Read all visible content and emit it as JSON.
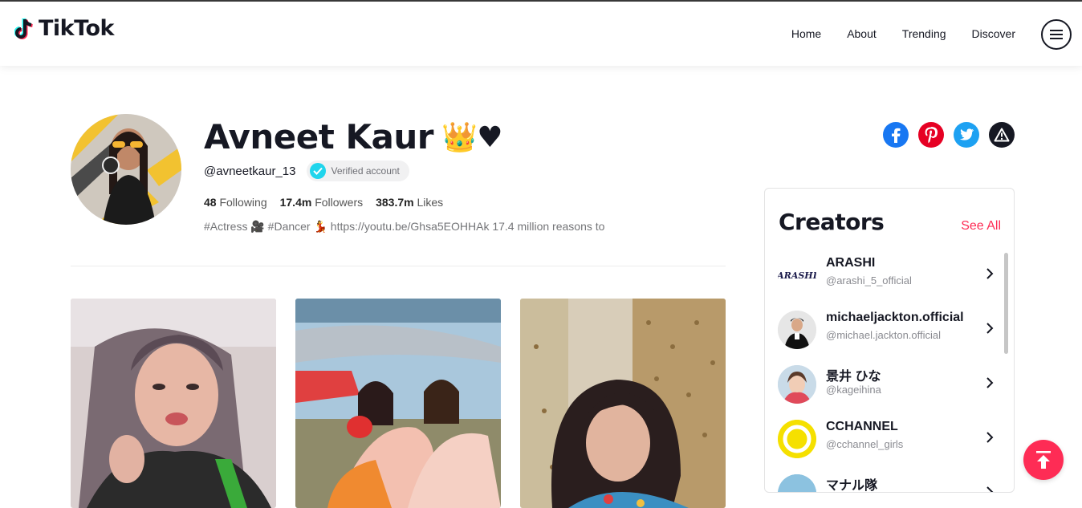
{
  "header": {
    "logo_text": "TikTok",
    "nav": [
      {
        "label": "Home"
      },
      {
        "label": "About"
      },
      {
        "label": "Trending"
      },
      {
        "label": "Discover"
      }
    ],
    "menu_icon": "hamburger-icon"
  },
  "profile": {
    "display_name": "Avneet Kaur",
    "name_emoji": "👑♥",
    "handle": "@avneetkaur_13",
    "verified_label": "Verified account",
    "stats": {
      "following_count": "48",
      "following_label": "Following",
      "followers_count": "17.4m",
      "followers_label": "Followers",
      "likes_count": "383.7m",
      "likes_label": "Likes"
    },
    "bio": "#Actress 🎥 #Dancer 💃 https://youtu.be/Ghsa5EOHHAk 17.4 million reasons to"
  },
  "share": {
    "icons": [
      "facebook-icon",
      "pinterest-icon",
      "twitter-icon",
      "report-icon"
    ],
    "colors": {
      "facebook": "#1877f2",
      "pinterest": "#e60023",
      "twitter": "#1da1f2",
      "report": "#161823"
    }
  },
  "creators": {
    "title": "Creators",
    "see_all": "See All",
    "items": [
      {
        "name": "ARASHI",
        "handle": "@arashi_5_official",
        "avatar_text": "ARASHI"
      },
      {
        "name": "michaeljackton.official",
        "handle": "@michael.jackton.official"
      },
      {
        "name": "景井 ひな",
        "handle": "@kageihina"
      },
      {
        "name": "CCHANNEL",
        "handle": "@cchannel_girls"
      },
      {
        "name": "マナル隊",
        "handle": ""
      }
    ]
  },
  "colors": {
    "accent": "#fe2c55",
    "verified": "#20d5ec",
    "text": "#161823"
  }
}
